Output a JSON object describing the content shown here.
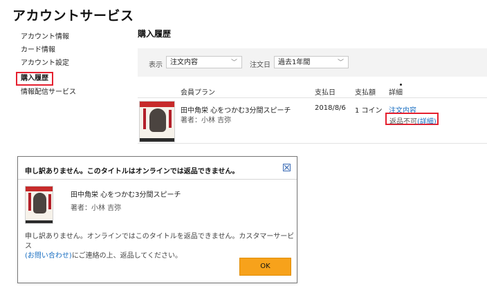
{
  "page": {
    "title": "アカウントサービス"
  },
  "sidebar": {
    "items": [
      {
        "label": "アカウント情報"
      },
      {
        "label": "カード情報"
      },
      {
        "label": "アカウント設定"
      },
      {
        "label": "購入履歴"
      },
      {
        "label": "情報配信サービス"
      }
    ]
  },
  "section": {
    "title": "購入履歴"
  },
  "filters": {
    "show_label": "表示",
    "show_value": "注文内容",
    "date_label": "注文日",
    "date_value": "過去1年間"
  },
  "table": {
    "headers": [
      "会員プラン",
      "支払日",
      "支払額",
      "詳細"
    ],
    "row": {
      "title": "田中角栄 心をつかむ3分間スピーチ",
      "author": "著者：小林 吉弥",
      "date": "2018/8/6",
      "amount": "1 コイン",
      "detail_link": "注文内容",
      "return_status": "返品不可",
      "return_detail_link": "(詳細)"
    }
  },
  "modal": {
    "title": "申し訳ありません。このタイトルはオンラインでは返品できません。",
    "book_title": "田中角栄 心をつかむ3分間スピーチ",
    "book_author": "著者：小林 吉弥",
    "message_line1": "申し訳ありません。オンラインではこのタイトルを返品できません。カスタマーサービス",
    "message_link": "(お問い合わせ)",
    "message_line2_rest": "にご連絡の上、返品してください。",
    "ok_label": "OK"
  },
  "colors": {
    "accent_red": "#e5202f",
    "link_blue": "#1a6fc2",
    "ok_orange": "#f7a21b"
  },
  "icons": {
    "close": "close-icon",
    "dropdown": "chevron-down-icon"
  }
}
